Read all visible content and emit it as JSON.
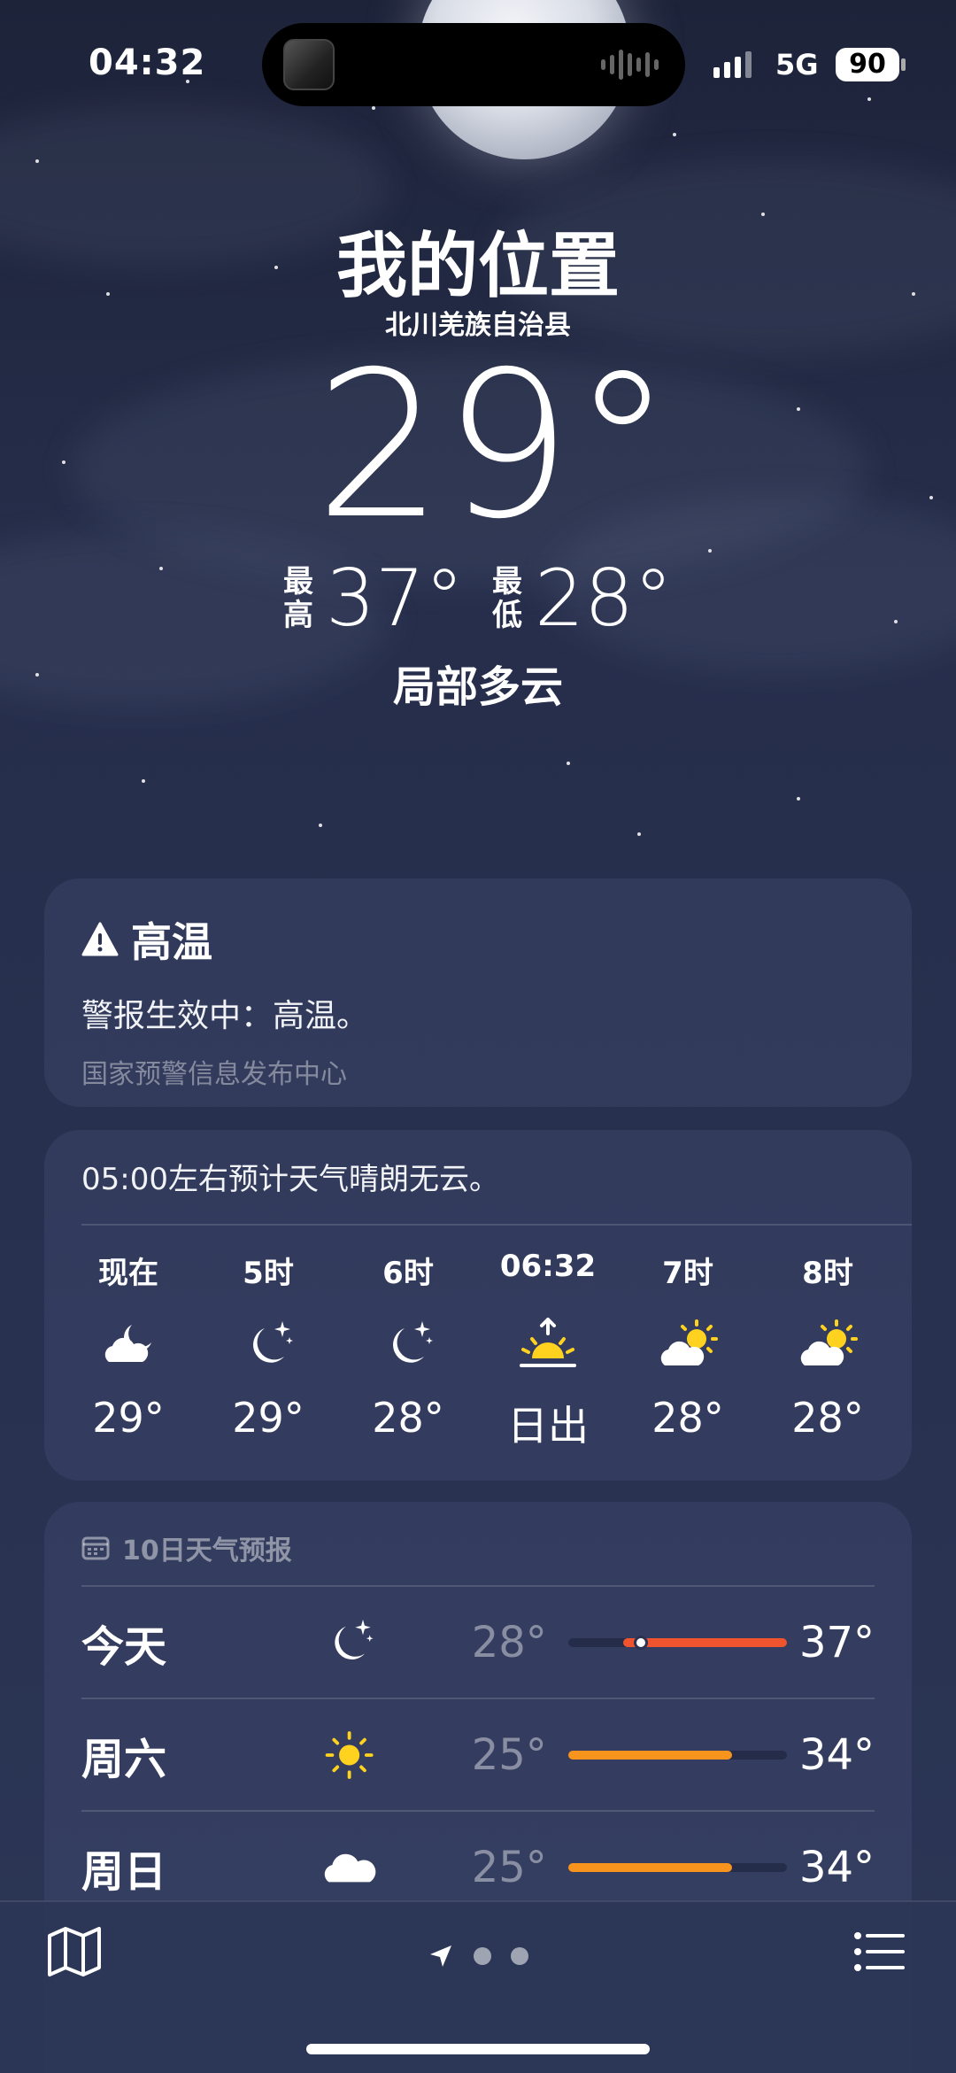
{
  "status_bar": {
    "time": "04:32",
    "network": "5G",
    "battery": "90"
  },
  "hero": {
    "title": "我的位置",
    "subtitle": "北川羌族自治县",
    "temperature": "29°",
    "high_label_1": "最",
    "high_label_2": "高",
    "high_value": "37°",
    "low_label_1": "最",
    "low_label_2": "低",
    "low_value": "28°",
    "condition": "局部多云"
  },
  "alert": {
    "title": "高温",
    "body": "警报生效中：高温。",
    "source": "国家预警信息发布中心",
    "icon": "warning-triangle-icon"
  },
  "hourly": {
    "summary": "05:00左右预计天气晴朗无云。",
    "items": [
      {
        "label": "现在",
        "icon": "moon-cloud-icon",
        "temp": "29°"
      },
      {
        "label": "5时",
        "icon": "moon-stars-icon",
        "temp": "29°"
      },
      {
        "label": "6时",
        "icon": "moon-stars-icon",
        "temp": "28°"
      },
      {
        "label": "06:32",
        "icon": "sunrise-icon",
        "temp": "日出"
      },
      {
        "label": "7时",
        "icon": "sun-cloud-icon",
        "temp": "28°"
      },
      {
        "label": "8时",
        "icon": "sun-cloud-icon",
        "temp": "28°"
      }
    ]
  },
  "daily": {
    "header": "10日天气预报",
    "week_min": 25,
    "week_max": 37,
    "rows": [
      {
        "day": "今天",
        "icon": "moon-stars-icon",
        "low": "28°",
        "high": "37°",
        "low_value": 28,
        "high_value": 37,
        "current_value": 29,
        "color": "#f0542e"
      },
      {
        "day": "周六",
        "icon": "sun-icon",
        "low": "25°",
        "high": "34°",
        "low_value": 25,
        "high_value": 34,
        "color": "#f7941d"
      },
      {
        "day": "周日",
        "icon": "cloud-icon",
        "low": "25°",
        "high": "34°",
        "low_value": 25,
        "high_value": 34,
        "color": "#f7941d"
      }
    ]
  },
  "bottom_bar": {
    "map_icon": "map-icon",
    "location_icon": "location-arrow-icon",
    "list_icon": "list-icon"
  }
}
